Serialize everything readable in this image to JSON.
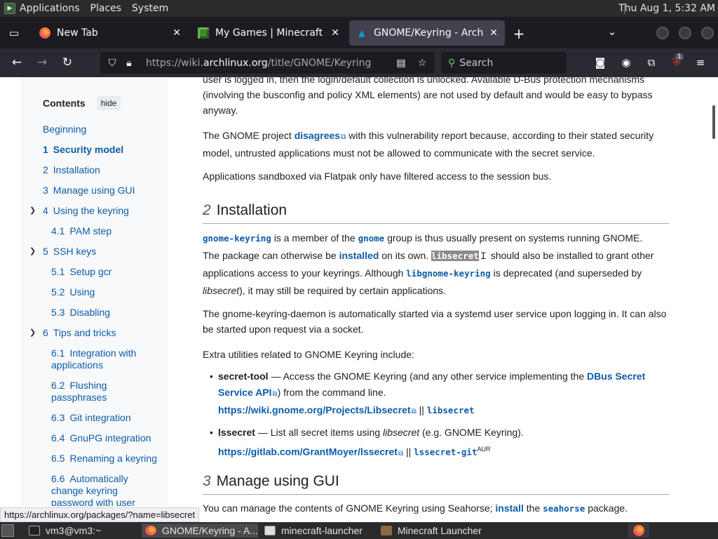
{
  "system_bar": {
    "menus": [
      "Applications",
      "Places",
      "System"
    ],
    "clock": "Thu Aug  1,  5:32 AM"
  },
  "tabs": [
    {
      "title": "New Tab",
      "icon": "firefox-icon"
    },
    {
      "title": "My Games | Minecraft",
      "icon": "minecraft-icon"
    },
    {
      "title": "GNOME/Keyring - ArchWiki",
      "icon": "archlinux-icon"
    }
  ],
  "nav": {
    "url_prefix": "https://wiki.",
    "url_host": "archlinux.org",
    "url_path": "/title/GNOME/Keyring",
    "search_placeholder": "Search",
    "badge_count": "1"
  },
  "toc": {
    "heading": "Contents",
    "hide_label": "hide",
    "items": [
      {
        "num": "",
        "label": "Beginning"
      },
      {
        "num": "1",
        "label": "Security model"
      },
      {
        "num": "2",
        "label": "Installation"
      },
      {
        "num": "3",
        "label": "Manage using GUI"
      },
      {
        "num": "4",
        "label": "Using the keyring"
      },
      {
        "num": "4.1",
        "label": "PAM step"
      },
      {
        "num": "5",
        "label": "SSH keys"
      },
      {
        "num": "5.1",
        "label": "Setup gcr"
      },
      {
        "num": "5.2",
        "label": "Using"
      },
      {
        "num": "5.3",
        "label": "Disabling"
      },
      {
        "num": "6",
        "label": "Tips and tricks"
      },
      {
        "num": "6.1",
        "label": "Integration with"
      },
      {
        "num": "",
        "label": "applications"
      },
      {
        "num": "6.2",
        "label": "Flushing"
      },
      {
        "num": "",
        "label": "passphrases"
      },
      {
        "num": "6.3",
        "label": "Git integration"
      },
      {
        "num": "6.4",
        "label": "GnuPG integration"
      },
      {
        "num": "6.5",
        "label": "Renaming a keyring"
      },
      {
        "num": "6.6",
        "label": "Automatically"
      },
      {
        "num": "",
        "label": "change keyring"
      },
      {
        "num": "",
        "label": "password with user"
      }
    ]
  },
  "content": {
    "p0a": "user is logged in, then the login/default collection is unlocked. Available D-Bus protection mechanisms",
    "p0b": "(involving the busconfig and policy XML elements) are not used by default and would be easy to bypass",
    "p0c": "anyway.",
    "p1_pre": "The GNOME project ",
    "p1_link": "disagrees",
    "p1_post": " with this vulnerability report because, according to their stated security",
    "p1_line2": "model, untrusted applications must not be allowed to communicate with the secret service.",
    "p2": "Applications sandboxed via Flatpak only have filtered access to the session bus.",
    "h_install_num": "2",
    "h_install": "Installation",
    "p3_pkg1": "gnome-keyring",
    "p3_t1": " is a member of the ",
    "p3_pkg2": "gnome",
    "p3_t2": " group is thus usually present on systems running GNOME.",
    "p3_t3": "The package can otherwise be ",
    "p3_installed": "installed",
    "p3_t4": " on its own. ",
    "p3_pkg3": "libsecret",
    "p3_t5": " should also be installed to grant other",
    "p3_t6": "applications access to your keyrings. Although ",
    "p3_pkg4": "libgnome-keyring",
    "p3_t7": " is deprecated (and superseded by",
    "p3_em": "libsecret",
    "p3_t8": "), it may still be required by certain applications.",
    "p4a": "The gnome-keyring-daemon is automatically started via a systemd user service upon logging in. It can also",
    "p4b": "be started upon request via a socket.",
    "p5": "Extra utilities related to GNOME Keyring include:",
    "b1_name": "secret-tool",
    "b1_t1": " — Access the GNOME Keyring (and any other service implementing the ",
    "b1_link1": "DBus Secret",
    "b1_link2": "Service API",
    "b1_t2": ") from the command line.",
    "b1_url": "https://wiki.gnome.org/Projects/Libsecret",
    "b1_sep": " || ",
    "b1_pkg": "libsecret",
    "b2_name": "lssecret",
    "b2_t1": " — List all secret items using ",
    "b2_em": "libsecret",
    "b2_t2": " (e.g. GNOME Keyring).",
    "b2_url": "https://gitlab.com/GrantMoyer/lssecret",
    "b2_sep": " || ",
    "b2_pkg": "lssecret-git",
    "b2_sup": "AUR",
    "h_gui_num": "3",
    "h_gui": "Manage using GUI",
    "p6_t1": "You can manage the contents of GNOME Keyring using Seahorse; ",
    "p6_link": "install",
    "p6_t2": " the ",
    "p6_pkg": "seahorse",
    "p6_t3": " package."
  },
  "status_link": "https://archlinux.org/packages/?name=libsecret",
  "taskbar": {
    "items": [
      {
        "label": "vm3@vm3:~",
        "icon": "terminal-icon"
      },
      {
        "label": "GNOME/Keyring - A...",
        "icon": "firefox-icon"
      },
      {
        "label": "minecraft-launcher",
        "icon": "document-icon"
      },
      {
        "label": "Minecraft Launcher",
        "icon": "minecraft-icon"
      }
    ]
  }
}
